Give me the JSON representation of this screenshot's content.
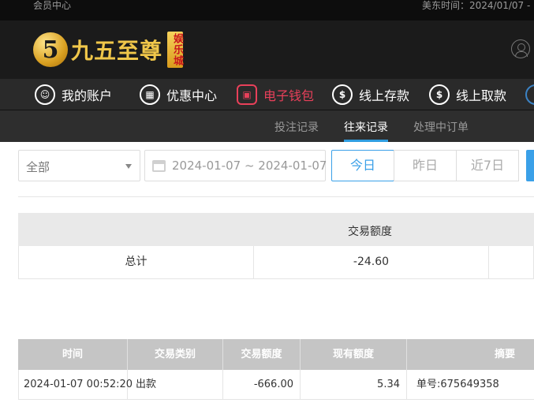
{
  "topbar": {
    "member_center": "会员中心",
    "est_time": "美东时间：2024/01/07 -"
  },
  "brand": {
    "logo_mark": "5",
    "name": "九五至尊",
    "sub": "娱乐城"
  },
  "nav": {
    "items": [
      {
        "label": "我的账户",
        "icon": "user-icon"
      },
      {
        "label": "优惠中心",
        "icon": "gift-icon"
      },
      {
        "label": "电子钱包",
        "icon": "wallet-icon"
      },
      {
        "label": "线上存款",
        "icon": "deposit-icon"
      },
      {
        "label": "线上取款",
        "icon": "withdraw-icon"
      }
    ],
    "active_color": "#e8405a"
  },
  "subnav": {
    "items": [
      "投注记录",
      "往来记录",
      "处理中订单"
    ],
    "active": "往来记录"
  },
  "filters": {
    "type_select": "全部",
    "date_range": "2024-01-07 ~ 2024-01-07",
    "buttons": [
      "今日",
      "昨日",
      "近7日"
    ],
    "accent": "#3aa0e8"
  },
  "summary": {
    "header": "交易额度",
    "row_label": "总计",
    "row_value": "-24.60"
  },
  "details": {
    "columns": [
      "时间",
      "交易类别",
      "交易额度",
      "现有额度",
      "摘要"
    ],
    "rows": [
      {
        "time": "2024-01-07 00:52:20",
        "type": "出款",
        "amount": "-666.00",
        "balance": "5.34",
        "memo": "单号:675649358"
      }
    ]
  }
}
